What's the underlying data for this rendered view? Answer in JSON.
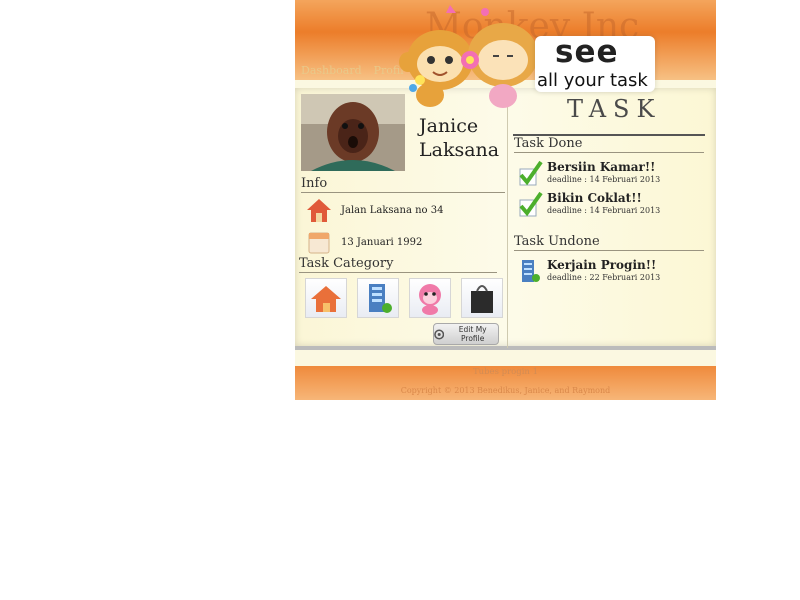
{
  "header": {
    "brand": "Monkey Inc",
    "nav": [
      {
        "label": "Dashboard"
      },
      {
        "label": "Profil"
      }
    ]
  },
  "banner": {
    "see": "see",
    "subtitle": "all your task"
  },
  "profile": {
    "name": "Janice Laksana",
    "info_title": "Info",
    "address": "Jalan Laksana no 34",
    "birthdate": "13 Januari 1992",
    "category_title": "Task Category",
    "categories": [
      {
        "icon": "home-icon"
      },
      {
        "icon": "office-building-icon"
      },
      {
        "icon": "pink-monkey-icon"
      },
      {
        "icon": "shopping-bag-icon"
      }
    ],
    "edit_button": "Edit My Profile"
  },
  "tasks": {
    "heading": "TASK",
    "done_title": "Task Done",
    "done": [
      {
        "title": "Bersiin Kamar!!",
        "deadline": "deadline : 14 Februari 2013"
      },
      {
        "title": "Bikin Coklat!!",
        "deadline": "deadline : 14 Februari 2013"
      }
    ],
    "undone_title": "Task Undone",
    "undone": [
      {
        "title": "Kerjain Progin!!",
        "deadline": "deadline : 22 Februari 2013"
      }
    ]
  },
  "footer": {
    "title": "Tubes progin 1",
    "copyright": "Copyright © 2013 Benedikus, Janice, and Raymond"
  },
  "colors": {
    "header_orange": "#ec7d2a",
    "body_cream": "#fbf8e1",
    "check_green": "#4caf2c"
  }
}
